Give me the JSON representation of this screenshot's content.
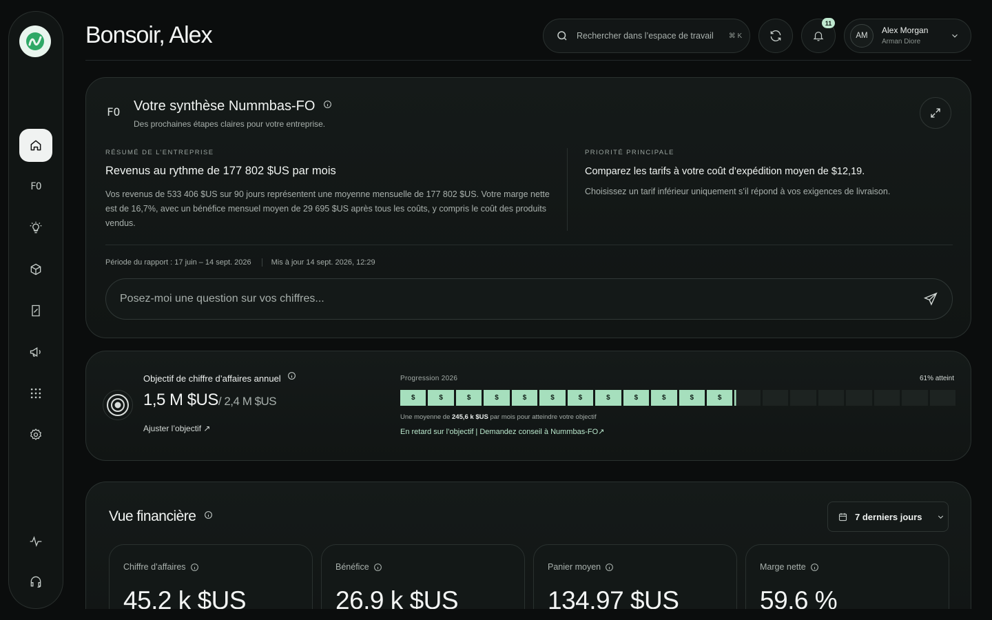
{
  "header": {
    "greeting": "Bonsoir, Alex",
    "search_placeholder": "Rechercher dans l’espace de travail",
    "search_shortcut": "⌘ K",
    "notifications_count": "11",
    "user_initials": "AM",
    "user_name": "Alex Morgan",
    "user_org": "Arman Diore"
  },
  "summary": {
    "title": "Votre synthèse Nummbas-FO",
    "subtitle": "Des prochaines étapes claires pour votre entreprise.",
    "left_label": "Résumé de l’entreprise",
    "left_heading": "Revenus au rythme de 177 802 $US par mois",
    "left_body": "Vos revenus de 533 406 $US sur 90 jours représentent une moyenne mensuelle de 177 802 $US. Votre marge nette est de 16,7%, avec un bénéfice mensuel moyen de 29 695 $US après tous les coûts, y compris le coût des produits vendus.",
    "right_label": "Priorité principale",
    "right_heading": "Comparez les tarifs à votre coût d’expédition moyen de $12,19.",
    "right_body": "Choisissez un tarif inférieur uniquement s’il répond à vos exigences de livraison.",
    "period": "Période du rapport : 17 juin – 14 sept. 2026",
    "updated": "Mis à jour 14 sept. 2026, 12:29",
    "ask_placeholder": "Posez-moi une question sur vos chiffres..."
  },
  "goal": {
    "title": "Objectif de chiffre d’affaires annuel",
    "current": "1,5 M $US",
    "target": "/ 2,4 M $US",
    "adjust_label": "Ajuster l’objectif ↗",
    "progress_label": "Progression 2026",
    "progress_pct_label": "61% atteint",
    "progress_fraction": 0.61,
    "segment_symbol": "$",
    "avg_prefix": "Une moyenne de",
    "avg_value": "245,6 k $US",
    "avg_suffix": "par mois pour atteindre votre objectif",
    "advice_link": "En retard sur l’objectif | Demandez conseil à Nummbas-FO↗"
  },
  "finance": {
    "title": "Vue financière",
    "range_label": "7 derniers jours",
    "metrics": [
      {
        "label": "Chiffre d’affaires",
        "value": "45,2 k $US"
      },
      {
        "label": "Bénéfice",
        "value": "26,9 k $US"
      },
      {
        "label": "Panier moyen",
        "value": "134,97 $US"
      },
      {
        "label": "Marge nette",
        "value": "59,6 %"
      }
    ]
  },
  "colors": {
    "accent": "#a6dfbd",
    "background": "#0b0d0d",
    "logo": "#2fa866"
  },
  "sidebar": {
    "items": [
      "home-icon",
      "fo-icon",
      "lightbulb-icon",
      "box-icon",
      "receipt-icon",
      "megaphone-icon",
      "apps-grid-icon",
      "settings-icon",
      "activity-icon",
      "headset-icon"
    ]
  }
}
